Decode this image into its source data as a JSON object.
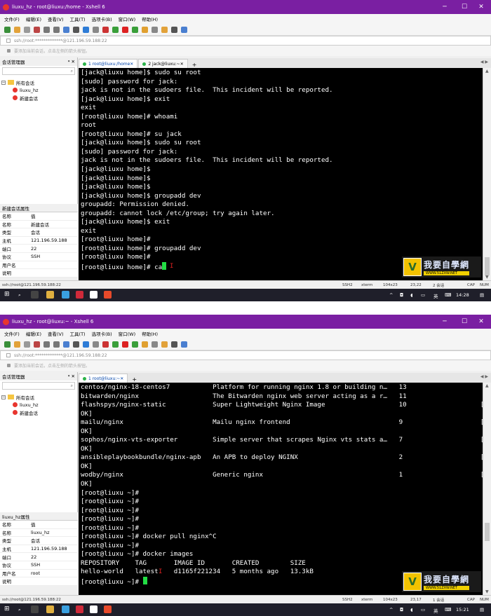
{
  "screens": [
    {
      "title": "liuxu_hz - root@liuxu:/home - Xshell 6",
      "menu": [
        "文件(F)",
        "编辑(E)",
        "查看(V)",
        "工具(T)",
        "选项卡(B)",
        "窗口(W)",
        "帮助(H)"
      ],
      "address": "ssh://root:*************@121.196.59.188:22",
      "tip": "要添加当前会话，点击左侧的箭头按钮。",
      "session_manager": "会话管理器",
      "tree": {
        "root": "所有会话",
        "items": [
          "liuxu_hz",
          "新建会话"
        ]
      },
      "props_title": "新建会话属性",
      "props_header": [
        "名称",
        "值"
      ],
      "props": [
        [
          "名称",
          "新建会话"
        ],
        [
          "类型",
          "会话"
        ],
        [
          "主机",
          "121.196.59.188"
        ],
        [
          "端口",
          "22"
        ],
        [
          "协议",
          "SSH"
        ],
        [
          "用户名",
          ""
        ],
        [
          "说明",
          ""
        ]
      ],
      "tabs": [
        "1 root@liuxu:/home",
        "2 jack@liuxu:~"
      ],
      "terminal": [
        "[jack@liuxu home]$ sudo su root",
        "[sudo] password for jack:",
        "jack is not in the sudoers file.  This incident will be reported.",
        "[jack@liuxu home]$ exit",
        "exit",
        "[root@liuxu home]# whoami",
        "root",
        "[root@liuxu home]# su jack",
        "[jack@liuxu home]$ sudo su root",
        "[sudo] password for jack:",
        "jack is not in the sudoers file.  This incident will be reported.",
        "[jack@liuxu home]$",
        "[jack@liuxu home]$",
        "[jack@liuxu home]$",
        "[jack@liuxu home]$ groupadd dev",
        "groupadd: Permission denied.",
        "groupadd: cannot lock /etc/group; try again later.",
        "[jack@liuxu home]$ exit",
        "exit",
        "[root@liuxu home]#",
        "[root@liuxu home]# groupadd dev",
        "[root@liuxu home]#",
        "[root@liuxu home]# ca"
      ],
      "status": {
        "left": "ssh://root@121.196.59.188:22",
        "proto": "SSH2",
        "term": "xterm",
        "size": "104x23",
        "pos": "23,22",
        "sessions": "2 会话",
        "caps": "CAP",
        "num": "NUM"
      },
      "clock": "14:28",
      "ime": "英"
    },
    {
      "title": "liuxu_hz - root@liuxu:~ - Xshell 6",
      "menu": [
        "文件(F)",
        "编辑(E)",
        "查看(V)",
        "工具(T)",
        "选项卡(B)",
        "窗口(W)",
        "帮助(H)"
      ],
      "address": "ssh://root:*************@121.196.59.188:22",
      "tip": "要添加当前会话，点击左侧的箭头按钮。",
      "session_manager": "会话管理器",
      "tree": {
        "root": "所有会话",
        "items": [
          "liuxu_hz",
          "新建会话"
        ]
      },
      "props_title": "liuxu_hz属性",
      "props_header": [
        "名称",
        "值"
      ],
      "props": [
        [
          "名称",
          "liuxu_hz"
        ],
        [
          "类型",
          "会话"
        ],
        [
          "主机",
          "121.196.59.188"
        ],
        [
          "端口",
          "22"
        ],
        [
          "协议",
          "SSH"
        ],
        [
          "用户名",
          "root"
        ],
        [
          "说明",
          ""
        ]
      ],
      "tabs": [
        "1 root@liuxu:~"
      ],
      "terminal": [
        "centos/nginx-18-centos7           Platform for running nginx 1.8 or building n…   13",
        "bitwarden/nginx                   The Bitwarden nginx web server acting as a r…   11",
        "flashspys/nginx-static            Super Lightweight Nginx Image                   10                   [",
        "OK]",
        "mailu/nginx                       Mailu nginx frontend                            9                    [",
        "OK]",
        "sophos/nginx-vts-exporter         Simple server that scrapes Nginx vts stats a…   7                    [",
        "OK]",
        "ansibleplaybookbundle/nginx-apb   An APB to deploy NGINX                          2                    [",
        "OK]",
        "wodby/nginx                       Generic nginx                                   1                    [",
        "OK]",
        "[root@liuxu ~]#",
        "[root@liuxu ~]#",
        "[root@liuxu ~]#",
        "[root@liuxu ~]#",
        "[root@liuxu ~]#",
        "[root@liuxu ~]# docker pull nginx^C",
        "[root@liuxu ~]#",
        "[root@liuxu ~]# docker images",
        "REPOSITORY    TAG       IMAGE ID       CREATED        SIZE",
        "hello-world   latest    d1165f221234   5 months ago   13.3kB",
        "[root@liuxu ~]# "
      ],
      "status": {
        "left": "ssh://root@121.196.59.188:22",
        "proto": "SSH2",
        "term": "xterm",
        "size": "104x23",
        "pos": "23,17",
        "sessions": "1 会话",
        "caps": "CAP",
        "num": "NUM"
      },
      "clock": "15:21",
      "ime": "英"
    }
  ],
  "watermark": {
    "text": "我要自學網",
    "url": "WWW.51ZXW.NET"
  },
  "colors": {
    "titlebar": "#7a1fa2",
    "terminal_bg": "#000000",
    "cursor": "#22dd44",
    "taskbar": "#1f1f2a"
  }
}
